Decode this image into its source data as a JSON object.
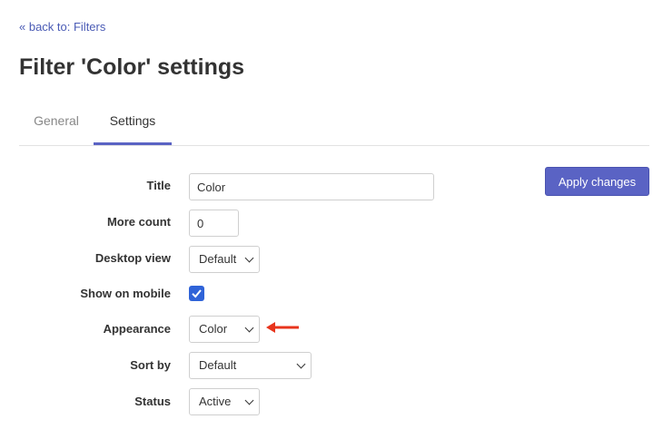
{
  "back_link": "« back to: Filters",
  "title": "Filter 'Color' settings",
  "tabs": [
    {
      "label": "General",
      "active": false
    },
    {
      "label": "Settings",
      "active": true
    }
  ],
  "apply_button": "Apply changes",
  "fields": {
    "title": {
      "label": "Title",
      "value": "Color"
    },
    "more_count": {
      "label": "More count",
      "value": "0"
    },
    "desktop_view": {
      "label": "Desktop view",
      "value": "Default"
    },
    "show_on_mobile": {
      "label": "Show on mobile",
      "checked": true
    },
    "appearance": {
      "label": "Appearance",
      "value": "Color"
    },
    "sort_by": {
      "label": "Sort by",
      "value": "Default"
    },
    "status": {
      "label": "Status",
      "value": "Active"
    }
  },
  "colors": {
    "accent": "#5a63c4",
    "checkbox": "#2f63d8",
    "arrow": "#e8341c"
  },
  "annotation": {
    "icon": "red-arrow-left-icon"
  }
}
